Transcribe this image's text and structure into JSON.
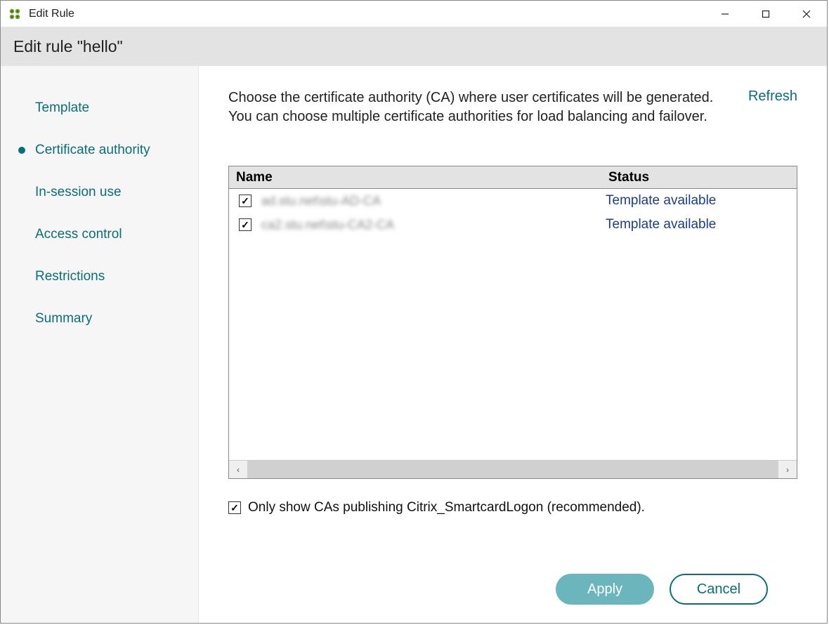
{
  "window": {
    "title": "Edit Rule",
    "subtitle": "Edit rule \"hello\""
  },
  "sidebar": {
    "items": [
      {
        "label": "Template",
        "active": false
      },
      {
        "label": "Certificate authority",
        "active": true
      },
      {
        "label": "In-session use",
        "active": false
      },
      {
        "label": "Access control",
        "active": false
      },
      {
        "label": "Restrictions",
        "active": false
      },
      {
        "label": "Summary",
        "active": false
      }
    ]
  },
  "main": {
    "description": "Choose the certificate authority (CA) where user certificates will be generated. You can choose multiple certificate authorities for load balancing and failover.",
    "refresh_label": "Refresh",
    "table": {
      "columns": {
        "name": "Name",
        "status": "Status"
      },
      "rows": [
        {
          "checked": true,
          "name": "ad.stu.net\\stu-AD-CA",
          "status": "Template available"
        },
        {
          "checked": true,
          "name": "ca2.stu.net\\stu-CA2-CA",
          "status": "Template available"
        }
      ]
    },
    "filter": {
      "checked": true,
      "label": "Only show CAs publishing Citrix_SmartcardLogon (recommended)."
    }
  },
  "footer": {
    "apply": "Apply",
    "cancel": "Cancel"
  }
}
